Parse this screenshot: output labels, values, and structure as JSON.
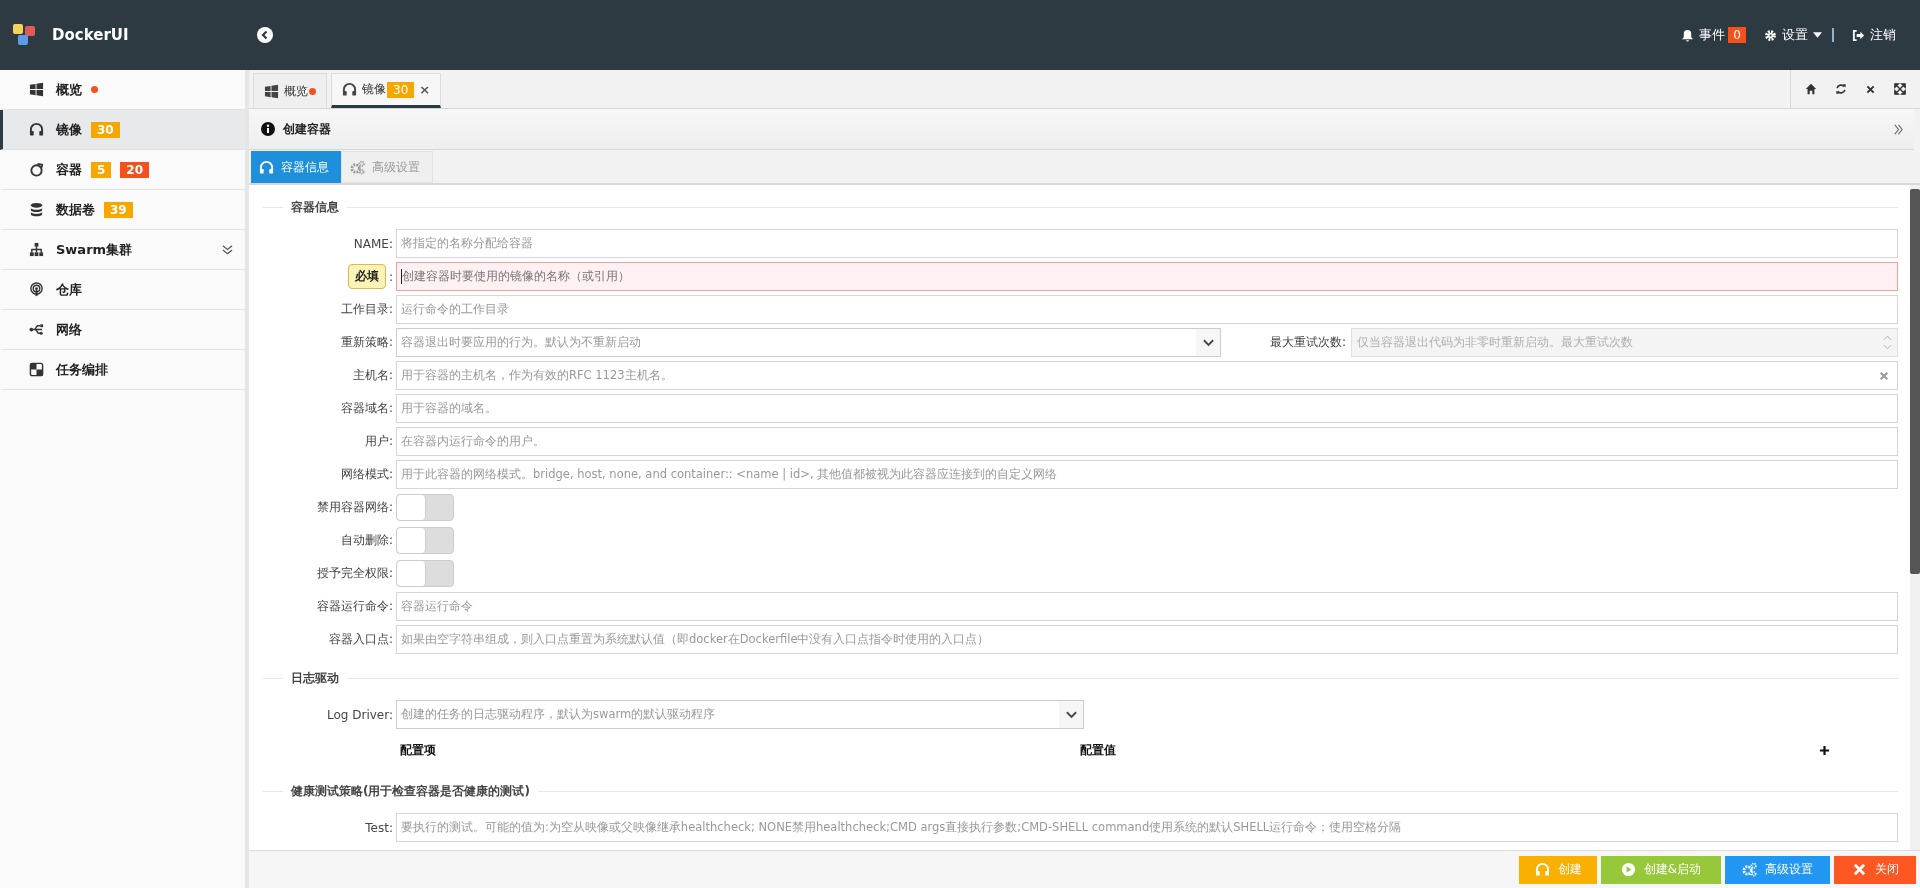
{
  "header": {
    "brand": "DockerUI",
    "events": {
      "label": "事件",
      "count": "0"
    },
    "settings": {
      "label": "设置"
    },
    "logout": {
      "label": "注销"
    }
  },
  "sidebar": {
    "items": [
      {
        "label": "概览",
        "kind": "link",
        "selected": false,
        "color": "#f4511e"
      },
      {
        "label": "镜像",
        "kind": "link",
        "selected": true,
        "badges": [
          {
            "text": "30",
            "color": "#f5a700"
          }
        ]
      },
      {
        "label": "容器",
        "kind": "link",
        "selected": false,
        "badges": [
          {
            "text": "5",
            "color": "#f5a700"
          },
          {
            "text": "20",
            "color": "#f4511e"
          }
        ]
      },
      {
        "label": "数据卷",
        "kind": "link",
        "selected": false,
        "badges": [
          {
            "text": "39",
            "color": "#f5a700"
          }
        ]
      },
      {
        "label": "Swarm集群",
        "kind": "group",
        "selected": false
      },
      {
        "label": "仓库",
        "kind": "link",
        "selected": false
      },
      {
        "label": "网络",
        "kind": "link",
        "selected": false
      },
      {
        "label": "任务编排",
        "kind": "link",
        "selected": false
      }
    ]
  },
  "tabs": [
    {
      "label": "概览",
      "selected": false,
      "color": "#f4511e"
    },
    {
      "label": "镜像",
      "selected": true,
      "badge": "30",
      "close": "×"
    }
  ],
  "panel": {
    "title": "创建容器",
    "subtabs": [
      {
        "label": "容器信息",
        "selected": true,
        "disabled": false
      },
      {
        "label": "高级设置",
        "selected": false,
        "disabled": true
      }
    ],
    "sections": [
      {
        "title": "容器信息",
        "fields": [
          {
            "kind": "text",
            "label": "NAME:",
            "placeholder": "将指定的名称分配给容器"
          },
          {
            "kind": "required",
            "label": ":",
            "tooltip": "必填",
            "placeholder": "创建容器时要使用的镜像的名称（或引用）"
          },
          {
            "kind": "text",
            "label": "工作目录:",
            "placeholder": "运行命令的工作目录"
          },
          {
            "kind": "select",
            "label": "重新策略:",
            "placeholder": "容器退出时要应用的行为。默认为不重新启动",
            "extra": {
              "label": "最大重试次数:",
              "placeholder": "仅当容器退出代码为非零时重新启动。最大重试次数",
              "disabled": true
            }
          },
          {
            "kind": "clearable",
            "label": "主机名:",
            "placeholder": "用于容器的主机名，作为有效的RFC 1123主机名。"
          },
          {
            "kind": "text",
            "label": "容器域名:",
            "placeholder": "用于容器的域名。"
          },
          {
            "kind": "text",
            "label": "用户:",
            "placeholder": "在容器内运行命令的用户。"
          },
          {
            "kind": "text",
            "label": "网络模式:",
            "placeholder": "用于此容器的网络模式。bridge, host, none, and container::  <name | id>, 其他值都被视为此容器应连接到的自定义网络"
          },
          {
            "kind": "toggle",
            "label": "禁用容器网络:",
            "on": false
          },
          {
            "kind": "toggle",
            "label": "自动删除:",
            "on": false
          },
          {
            "kind": "toggle",
            "label": "授予完全权限:",
            "on": false
          },
          {
            "kind": "text",
            "label": "容器运行命令:",
            "placeholder": "容器运行命令"
          },
          {
            "kind": "text",
            "label": "容器入口点:",
            "placeholder": "如果由空字符串组成，则入口点重置为系统默认值（即docker在Dockerfile中没有入口点指令时使用的入口点）"
          }
        ]
      },
      {
        "title": "日志驱动",
        "fields": [
          {
            "kind": "select-narrow",
            "label": "Log Driver:",
            "placeholder": "创建的任务的日志驱动程序，默认为swarm的默认驱动程序"
          }
        ],
        "columns": [
          "配置项",
          "配置值"
        ]
      },
      {
        "title": "健康测试策略(用于检查容器是否健康的测试)",
        "fields": [
          {
            "kind": "text",
            "label": "Test:",
            "placeholder": "要执行的测试。可能的值为:为空从映像或父映像继承healthcheck; NONE禁用healthcheck;CMD args直接执行参数;CMD-SHELL command使用系统的默认SHELL运行命令；使用空格分隔"
          }
        ]
      }
    ]
  },
  "footer": {
    "buttons": [
      {
        "label": "创建",
        "kind": "create",
        "color": "#f9b000"
      },
      {
        "label": "创建&启动",
        "kind": "start",
        "color": "#96c83a"
      },
      {
        "label": "高级设置",
        "kind": "advanced",
        "color": "#2196f3"
      },
      {
        "label": "关闭",
        "kind": "close",
        "color": "#ff5722"
      }
    ]
  }
}
